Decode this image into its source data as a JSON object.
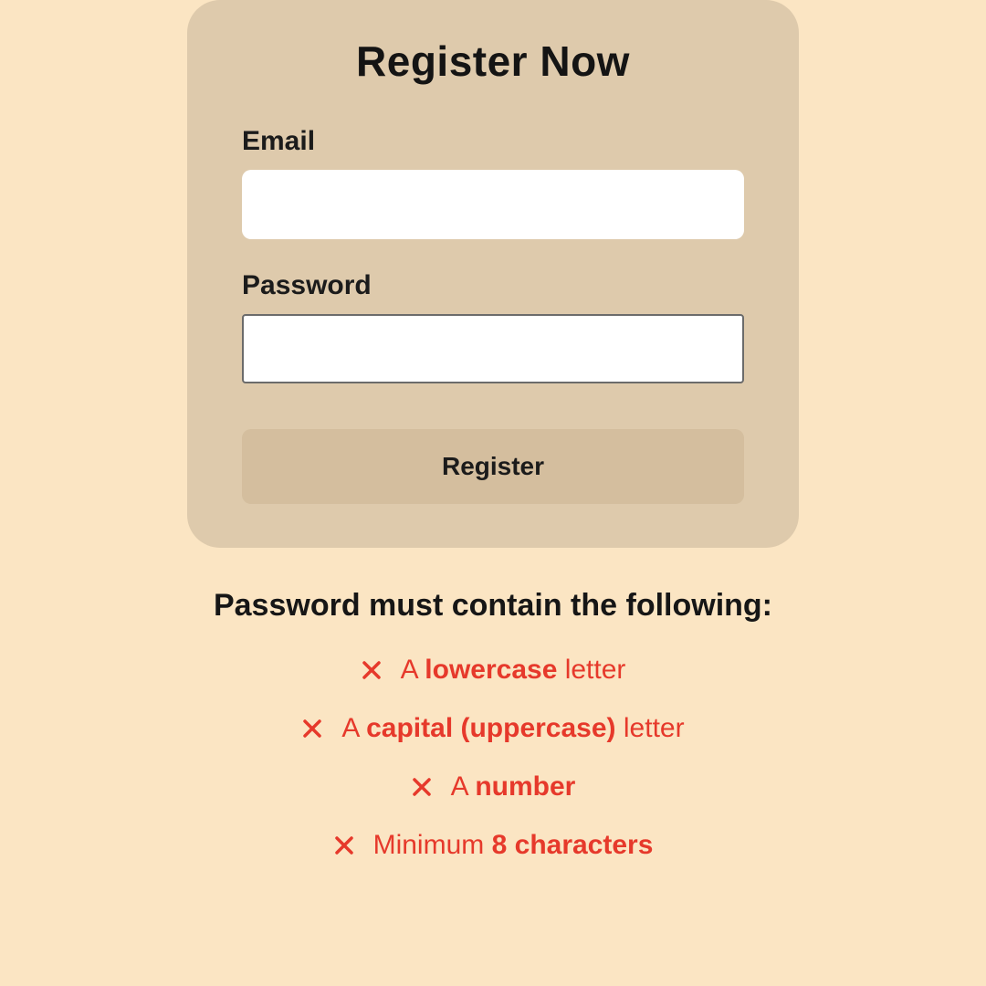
{
  "card": {
    "title": "Register Now",
    "email_label": "Email",
    "email_value": "",
    "password_label": "Password",
    "password_value": "",
    "register_label": "Register"
  },
  "rules": {
    "title": "Password must contain the following:",
    "items": [
      {
        "pre": "A ",
        "bold": "lowercase",
        "post": " letter",
        "valid": false
      },
      {
        "pre": "A ",
        "bold": "capital (uppercase)",
        "post": " letter",
        "valid": false
      },
      {
        "pre": "A ",
        "bold": "number",
        "post": "",
        "valid": false
      },
      {
        "pre": "Minimum ",
        "bold": "8 characters",
        "post": "",
        "valid": false
      }
    ]
  },
  "colors": {
    "invalid": "#E6392B"
  }
}
